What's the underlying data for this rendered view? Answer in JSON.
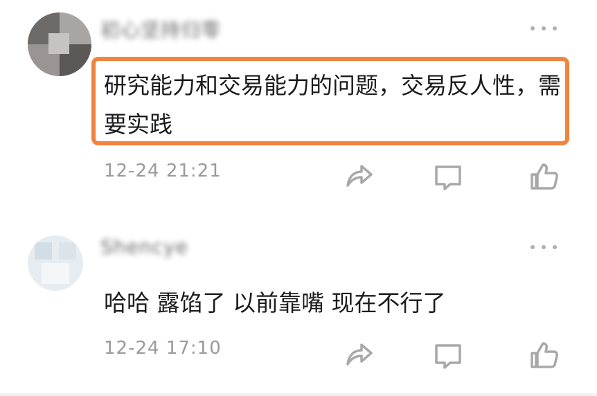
{
  "comments": [
    {
      "username": "初心坚持归零",
      "content": "研究能力和交易能力的问题，交易反人性，需要实践",
      "timestamp": "12-24 21:21",
      "highlighted": true,
      "highlight_color": "#f0843f"
    },
    {
      "username": "Shencye",
      "content": "哈哈 露馅了 以前靠嘴 现在不行了",
      "timestamp": "12-24 17:10",
      "highlighted": false
    }
  ],
  "icons": {
    "more": "more-icon",
    "share": "share-icon",
    "reply": "comment-icon",
    "like": "thumbs-up-icon"
  },
  "colors": {
    "highlight": "#f0843f",
    "timestamp": "#9a9a9a",
    "icon": "#a8a8a8"
  }
}
